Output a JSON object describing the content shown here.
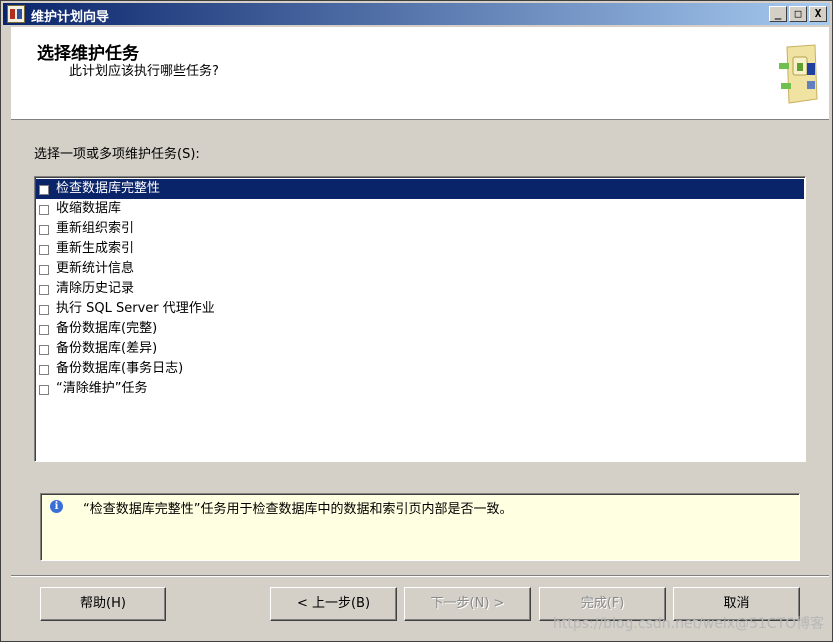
{
  "window": {
    "title": "维护计划向导",
    "minimize_label": "_",
    "maximize_label": "□",
    "close_label": "X"
  },
  "header": {
    "title": "选择维护任务",
    "subtitle": "此计划应该执行哪些任务?"
  },
  "prompt": "选择一项或多项维护任务(S):",
  "tasks": [
    {
      "label": "检查数据库完整性",
      "checked": false,
      "selected": true
    },
    {
      "label": "收缩数据库",
      "checked": false,
      "selected": false
    },
    {
      "label": "重新组织索引",
      "checked": false,
      "selected": false
    },
    {
      "label": "重新生成索引",
      "checked": false,
      "selected": false
    },
    {
      "label": "更新统计信息",
      "checked": false,
      "selected": false
    },
    {
      "label": "清除历史记录",
      "checked": false,
      "selected": false
    },
    {
      "label": "执行 SQL Server 代理作业",
      "checked": false,
      "selected": false
    },
    {
      "label": "备份数据库(完整)",
      "checked": false,
      "selected": false
    },
    {
      "label": "备份数据库(差异)",
      "checked": false,
      "selected": false
    },
    {
      "label": "备份数据库(事务日志)",
      "checked": false,
      "selected": false
    },
    {
      "label": "“清除维护”任务",
      "checked": false,
      "selected": false
    }
  ],
  "description": {
    "icon": "info-icon",
    "text": "“检查数据库完整性”任务用于检查数据库中的数据和索引页内部是否一致。"
  },
  "buttons": {
    "help": "帮助(H)",
    "back": "< 上一步(B)",
    "next": "下一步(N) >",
    "finish": "完成(F)",
    "cancel": "取消"
  },
  "watermark": "https://blog.csdn.net/weix@51CTO博客"
}
